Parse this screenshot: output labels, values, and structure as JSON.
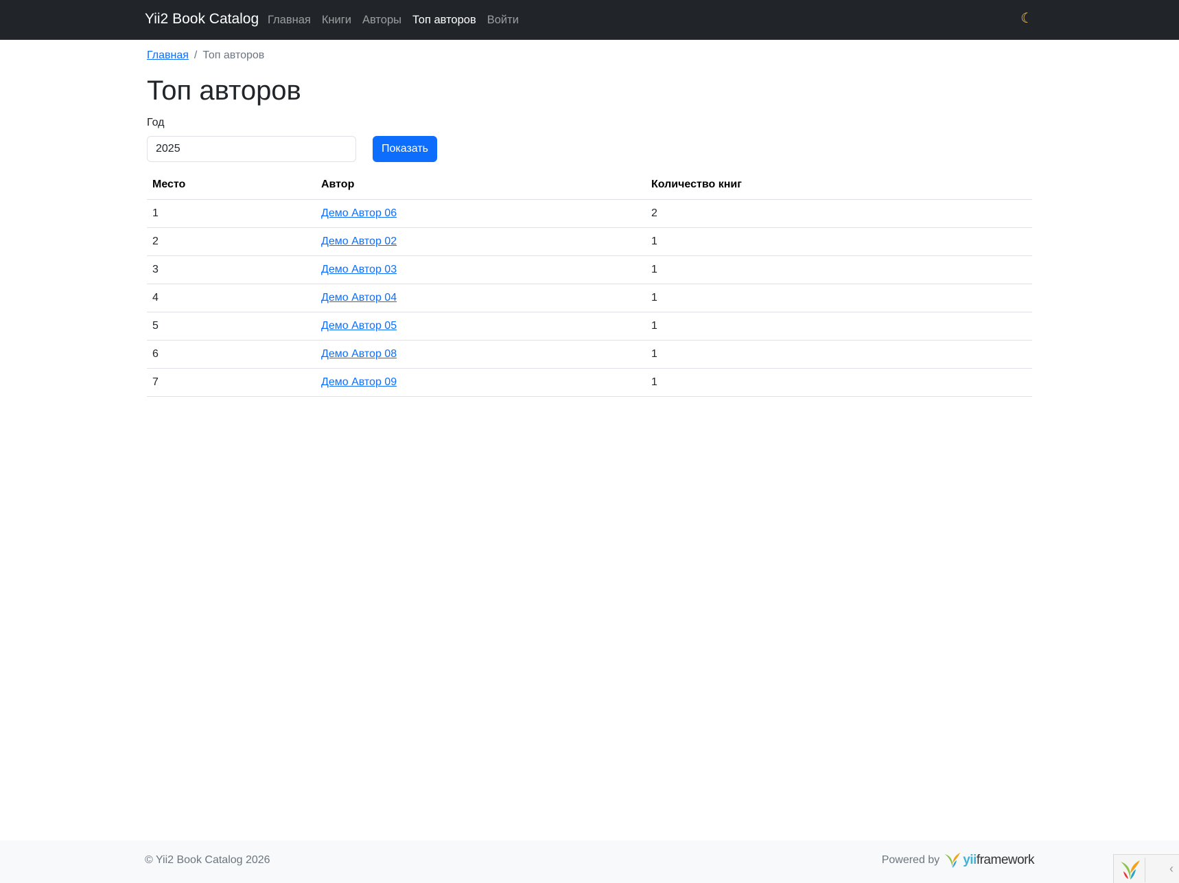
{
  "navbar": {
    "brand": "Yii2 Book Catalog",
    "links": [
      {
        "label": "Главная",
        "active": false
      },
      {
        "label": "Книги",
        "active": false
      },
      {
        "label": "Авторы",
        "active": false
      },
      {
        "label": "Топ авторов",
        "active": true
      },
      {
        "label": "Войти",
        "active": false
      }
    ],
    "theme_icon": "moon-icon"
  },
  "breadcrumb": {
    "home": "Главная",
    "separator": "/",
    "current": "Топ авторов"
  },
  "page": {
    "title": "Топ авторов"
  },
  "filter": {
    "year_label": "Год",
    "year_value": "2025",
    "submit_label": "Показать"
  },
  "table": {
    "headers": [
      "Место",
      "Автор",
      "Количество книг"
    ],
    "rows": [
      {
        "rank": "1",
        "author": "Демо Автор 06",
        "count": "2"
      },
      {
        "rank": "2",
        "author": "Демо Автор 02",
        "count": "1"
      },
      {
        "rank": "3",
        "author": "Демо Автор 03",
        "count": "1"
      },
      {
        "rank": "4",
        "author": "Демо Автор 04",
        "count": "1"
      },
      {
        "rank": "5",
        "author": "Демо Автор 05",
        "count": "1"
      },
      {
        "rank": "6",
        "author": "Демо Автор 08",
        "count": "1"
      },
      {
        "rank": "7",
        "author": "Демо Автор 09",
        "count": "1"
      }
    ]
  },
  "footer": {
    "copyright": "© Yii2 Book Catalog 2026",
    "powered_by": "Powered by",
    "framework_yii": "yii",
    "framework_rest": "framework"
  },
  "colors": {
    "navbar_bg": "#212529",
    "link": "#0d6efd",
    "primary_button": "#0d6efd",
    "footer_bg": "#f8f9fa"
  }
}
